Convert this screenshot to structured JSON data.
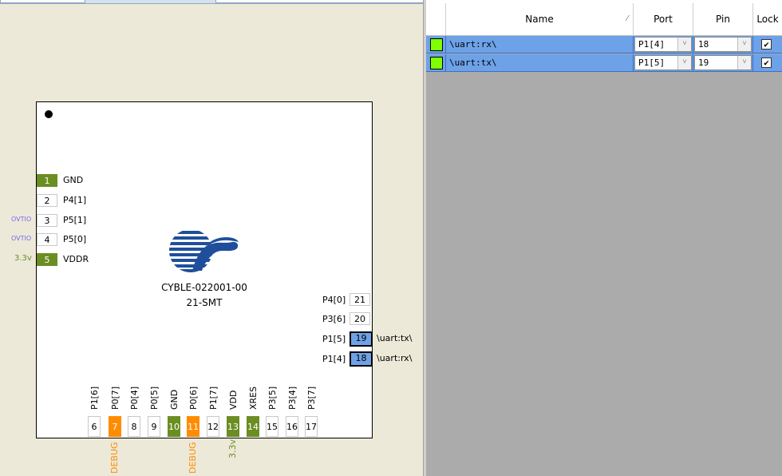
{
  "chip": {
    "part_number": "CYBLE-022001-00",
    "package": "21-SMT"
  },
  "left_pins": [
    {
      "num": "1",
      "name": "GND",
      "note": "",
      "style": "green"
    },
    {
      "num": "2",
      "name": "P4[1]",
      "note": "",
      "style": "plain"
    },
    {
      "num": "3",
      "name": "P5[1]",
      "note": "OVTIO",
      "style": "plain"
    },
    {
      "num": "4",
      "name": "P5[0]",
      "note": "OVTIO",
      "style": "plain"
    },
    {
      "num": "5",
      "name": "VDDR",
      "note": "3.3v",
      "style": "green"
    }
  ],
  "right_pins": [
    {
      "num": "21",
      "name": "P4[0]",
      "signal": "",
      "style": "plain"
    },
    {
      "num": "20",
      "name": "P3[6]",
      "signal": "",
      "style": "plain"
    },
    {
      "num": "19",
      "name": "P1[5]",
      "signal": "\\uart:tx\\",
      "style": "blue"
    },
    {
      "num": "18",
      "name": "P1[4]",
      "signal": "\\uart:rx\\",
      "style": "blue"
    }
  ],
  "bottom_pins": [
    {
      "num": "6",
      "name": "P1[6]",
      "note": "",
      "style": "plain"
    },
    {
      "num": "7",
      "name": "P0[7]",
      "note": "DEBUG",
      "style": "orange"
    },
    {
      "num": "8",
      "name": "P0[4]",
      "note": "",
      "style": "plain"
    },
    {
      "num": "9",
      "name": "P0[5]",
      "note": "",
      "style": "plain"
    },
    {
      "num": "10",
      "name": "GND",
      "note": "",
      "style": "green"
    },
    {
      "num": "11",
      "name": "P0[6]",
      "note": "DEBUG",
      "style": "orange"
    },
    {
      "num": "12",
      "name": "P1[7]",
      "note": "",
      "style": "plain"
    },
    {
      "num": "13",
      "name": "VDD",
      "note": "3.3v",
      "style": "green"
    },
    {
      "num": "14",
      "name": "XRES",
      "note": "",
      "style": "green"
    },
    {
      "num": "15",
      "name": "P3[5]",
      "note": "",
      "style": "plain"
    },
    {
      "num": "16",
      "name": "P3[4]",
      "note": "",
      "style": "plain"
    },
    {
      "num": "17",
      "name": "P3[7]",
      "note": "",
      "style": "plain"
    }
  ],
  "grid": {
    "headers": {
      "name": "Name",
      "port": "Port",
      "pin": "Pin",
      "lock": "Lock"
    },
    "sort_glyph": "⁄",
    "rows": [
      {
        "name": "\\uart:rx\\",
        "port": "P1[4]",
        "pin": "18",
        "locked": "✔"
      },
      {
        "name": "\\uart:tx\\",
        "port": "P1[5]",
        "pin": "19",
        "locked": "✔"
      }
    ]
  },
  "colors": {
    "power": "#6b8e23",
    "debug": "#ff8c00",
    "assigned": "#6ea2e8",
    "swatch": "#7fff00"
  },
  "icons": {
    "combo_arrow": "˅"
  }
}
